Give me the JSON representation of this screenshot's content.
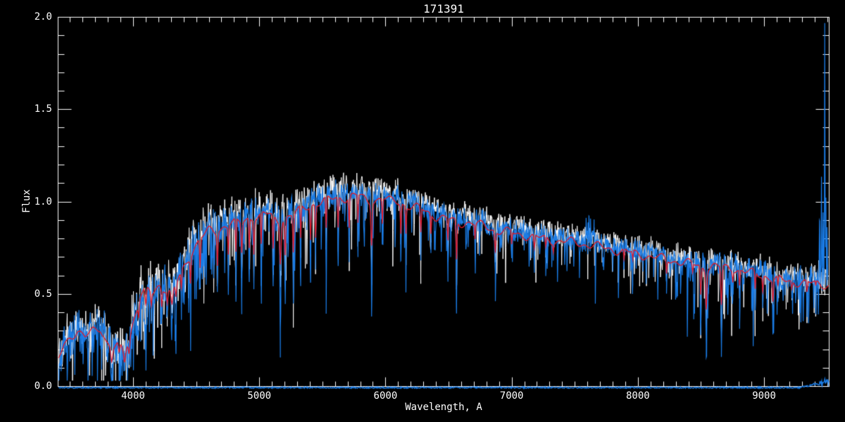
{
  "title": "171391",
  "colors": {
    "background": "#000000",
    "axis": "#ffffff",
    "observed_white": "#ffffff",
    "spectrum_blue": "#1a7ce6",
    "model_red": "#e01a28"
  },
  "chart_data": {
    "type": "line",
    "title": "171391",
    "xlabel": "Wavelength, A",
    "ylabel": "Flux",
    "xlim": [
      3403,
      9513
    ],
    "ylim": [
      0.0,
      2.0
    ],
    "grid": false,
    "legend": null,
    "x_ticks": {
      "major": [
        4000,
        5000,
        6000,
        7000,
        8000,
        9000
      ],
      "major_labels": [
        "4000",
        "5000",
        "6000",
        "7000",
        "8000",
        "9000"
      ],
      "minor_step": 100
    },
    "y_ticks": {
      "major": [
        0.0,
        0.5,
        1.0,
        1.5,
        2.0
      ],
      "major_labels": [
        "0.0",
        "0.5",
        "1.0",
        "1.5",
        "2.0"
      ],
      "minor_step": 0.1
    },
    "series": [
      {
        "name": "observed-spectrum",
        "color": "#ffffff",
        "role": "noisy observed flux, drawn under blue"
      },
      {
        "name": "calibrated-spectrum",
        "color": "#1a7ce6",
        "role": "noisy flux with absorption lines, main trace"
      },
      {
        "name": "model-fit",
        "color": "#e01a28",
        "role": "smooth template fit"
      },
      {
        "name": "error-spectrum",
        "color": "#1a7ce6",
        "role": "flat trace along zero flux"
      }
    ],
    "continuum": {
      "x": [
        3403,
        3450,
        3500,
        3560,
        3620,
        3680,
        3740,
        3790,
        3840,
        3890,
        3930,
        3970,
        4010,
        4060,
        4110,
        4160,
        4210,
        4260,
        4310,
        4360,
        4420,
        4480,
        4540,
        4600,
        4660,
        4720,
        4780,
        4840,
        4900,
        4960,
        5020,
        5080,
        5140,
        5200,
        5260,
        5320,
        5380,
        5440,
        5500,
        5560,
        5620,
        5680,
        5740,
        5800,
        5860,
        5920,
        5980,
        6040,
        6100,
        6160,
        6220,
        6280,
        6340,
        6400,
        6460,
        6520,
        6580,
        6640,
        6700,
        6760,
        6820,
        6880,
        6940,
        7000,
        7080,
        7160,
        7240,
        7320,
        7400,
        7480,
        7560,
        7640,
        7720,
        7800,
        7880,
        7960,
        8040,
        8120,
        8200,
        8280,
        8360,
        8440,
        8520,
        8600,
        8680,
        8760,
        8840,
        8920,
        9000,
        9080,
        9160,
        9240,
        9320,
        9400,
        9513
      ],
      "y": [
        0.13,
        0.22,
        0.27,
        0.3,
        0.26,
        0.3,
        0.32,
        0.24,
        0.2,
        0.22,
        0.18,
        0.26,
        0.38,
        0.49,
        0.52,
        0.5,
        0.55,
        0.53,
        0.5,
        0.58,
        0.66,
        0.75,
        0.81,
        0.84,
        0.83,
        0.87,
        0.89,
        0.88,
        0.9,
        0.92,
        0.93,
        0.93,
        0.89,
        0.91,
        0.93,
        0.95,
        0.97,
        0.99,
        1.0,
        1.01,
        1.02,
        1.02,
        1.03,
        1.03,
        1.0,
        1.01,
        1.02,
        1.0,
        1.0,
        0.98,
        0.97,
        0.96,
        0.94,
        0.92,
        0.91,
        0.9,
        0.88,
        0.89,
        0.88,
        0.87,
        0.86,
        0.84,
        0.84,
        0.83,
        0.82,
        0.81,
        0.8,
        0.79,
        0.785,
        0.78,
        0.77,
        0.765,
        0.75,
        0.74,
        0.73,
        0.72,
        0.71,
        0.7,
        0.69,
        0.68,
        0.67,
        0.66,
        0.645,
        0.65,
        0.64,
        0.64,
        0.62,
        0.61,
        0.6,
        0.58,
        0.57,
        0.565,
        0.56,
        0.555,
        0.55
      ]
    },
    "absorption_lines": [
      [
        3830,
        0.05,
        12
      ],
      [
        3890,
        0.08,
        10
      ],
      [
        3933,
        0.08,
        12
      ],
      [
        3969,
        0.1,
        10
      ],
      [
        4045,
        0.3,
        7
      ],
      [
        4101,
        0.3,
        9
      ],
      [
        4144,
        0.35,
        7
      ],
      [
        4227,
        0.33,
        7
      ],
      [
        4271,
        0.38,
        7
      ],
      [
        4308,
        0.34,
        12
      ],
      [
        4340,
        0.4,
        8
      ],
      [
        4383,
        0.4,
        7
      ],
      [
        4455,
        0.42,
        6
      ],
      [
        4531,
        0.45,
        7
      ],
      [
        4668,
        0.46,
        7
      ],
      [
        4755,
        0.55,
        6
      ],
      [
        4815,
        0.48,
        6
      ],
      [
        4861,
        0.52,
        9
      ],
      [
        4920,
        0.55,
        6
      ],
      [
        4957,
        0.52,
        7
      ],
      [
        5015,
        0.55,
        6
      ],
      [
        5110,
        0.5,
        7
      ],
      [
        5167,
        0.42,
        10
      ],
      [
        5205,
        0.48,
        8
      ],
      [
        5270,
        0.48,
        8
      ],
      [
        5328,
        0.56,
        6
      ],
      [
        5406,
        0.58,
        6
      ],
      [
        5446,
        0.6,
        6
      ],
      [
        5530,
        0.62,
        6
      ],
      [
        5625,
        0.65,
        6
      ],
      [
        5712,
        0.66,
        6
      ],
      [
        5782,
        0.7,
        5
      ],
      [
        5890,
        0.52,
        9
      ],
      [
        5975,
        0.72,
        5
      ],
      [
        6122,
        0.64,
        6
      ],
      [
        6162,
        0.66,
        6
      ],
      [
        6280,
        0.66,
        6
      ],
      [
        6360,
        0.7,
        5
      ],
      [
        6495,
        0.64,
        6
      ],
      [
        6563,
        0.42,
        7
      ],
      [
        6710,
        0.7,
        5
      ],
      [
        6870,
        0.6,
        8
      ],
      [
        7000,
        0.68,
        5
      ],
      [
        7180,
        0.64,
        7
      ],
      [
        7270,
        0.67,
        6
      ],
      [
        7330,
        0.7,
        5
      ],
      [
        7890,
        0.6,
        5
      ],
      [
        7960,
        0.62,
        5
      ],
      [
        8227,
        0.52,
        7
      ],
      [
        8434,
        0.55,
        6
      ],
      [
        8498,
        0.3,
        8
      ],
      [
        8542,
        0.19,
        9
      ],
      [
        8662,
        0.18,
        9
      ],
      [
        8752,
        0.52,
        5
      ],
      [
        8806,
        0.44,
        6
      ],
      [
        8930,
        0.4,
        6
      ],
      [
        8990,
        0.42,
        6
      ],
      [
        9070,
        0.33,
        7
      ],
      [
        9110,
        0.46,
        6
      ],
      [
        9220,
        0.48,
        6
      ],
      [
        9340,
        0.42,
        6
      ],
      [
        9410,
        0.5,
        5
      ]
    ],
    "emission_spikes": [
      [
        7590,
        0.1,
        4
      ],
      [
        7605,
        0.14,
        4
      ],
      [
        7613,
        0.13,
        4
      ],
      [
        7625,
        0.09,
        4
      ],
      [
        7653,
        0.07,
        4
      ],
      [
        9440,
        0.35,
        4
      ],
      [
        9455,
        0.55,
        4
      ],
      [
        9468,
        0.4,
        4
      ],
      [
        9481,
        1.42,
        5
      ],
      [
        9490,
        0.45,
        4
      ],
      [
        9500,
        0.35,
        4
      ]
    ],
    "white_offset": {
      "x": [
        3400,
        4300,
        5000,
        5800,
        6500,
        7500,
        8500,
        9500
      ],
      "y": [
        0.02,
        0.04,
        0.045,
        0.04,
        0.03,
        0.025,
        0.02,
        0.015
      ]
    },
    "noise_amp": {
      "x": [
        3400,
        3800,
        4100,
        4400,
        4800,
        5300,
        5800,
        6300,
        7000,
        7800,
        8600,
        9100,
        9500
      ],
      "y": [
        0.075,
        0.09,
        0.1,
        0.085,
        0.07,
        0.06,
        0.055,
        0.05,
        0.047,
        0.045,
        0.05,
        0.055,
        0.065
      ]
    },
    "dip_prob": {
      "x": [
        3400,
        4400,
        5000,
        5600,
        6500,
        7500,
        8500,
        9500
      ],
      "y": [
        0.22,
        0.2,
        0.16,
        0.12,
        0.1,
        0.11,
        0.13,
        0.12
      ]
    },
    "dip_depth": {
      "x": [
        3400,
        4200,
        5000,
        5600,
        6500,
        7500,
        8500,
        9500
      ],
      "y": [
        0.2,
        0.28,
        0.3,
        0.28,
        0.22,
        0.18,
        0.28,
        0.2
      ]
    },
    "error_trace": {
      "level": -0.008,
      "jitter": 0.004,
      "rise_start": 9280,
      "rise_amount": 0.035
    },
    "red_wiggle": 0.016,
    "noise_seed": 1713911
  }
}
